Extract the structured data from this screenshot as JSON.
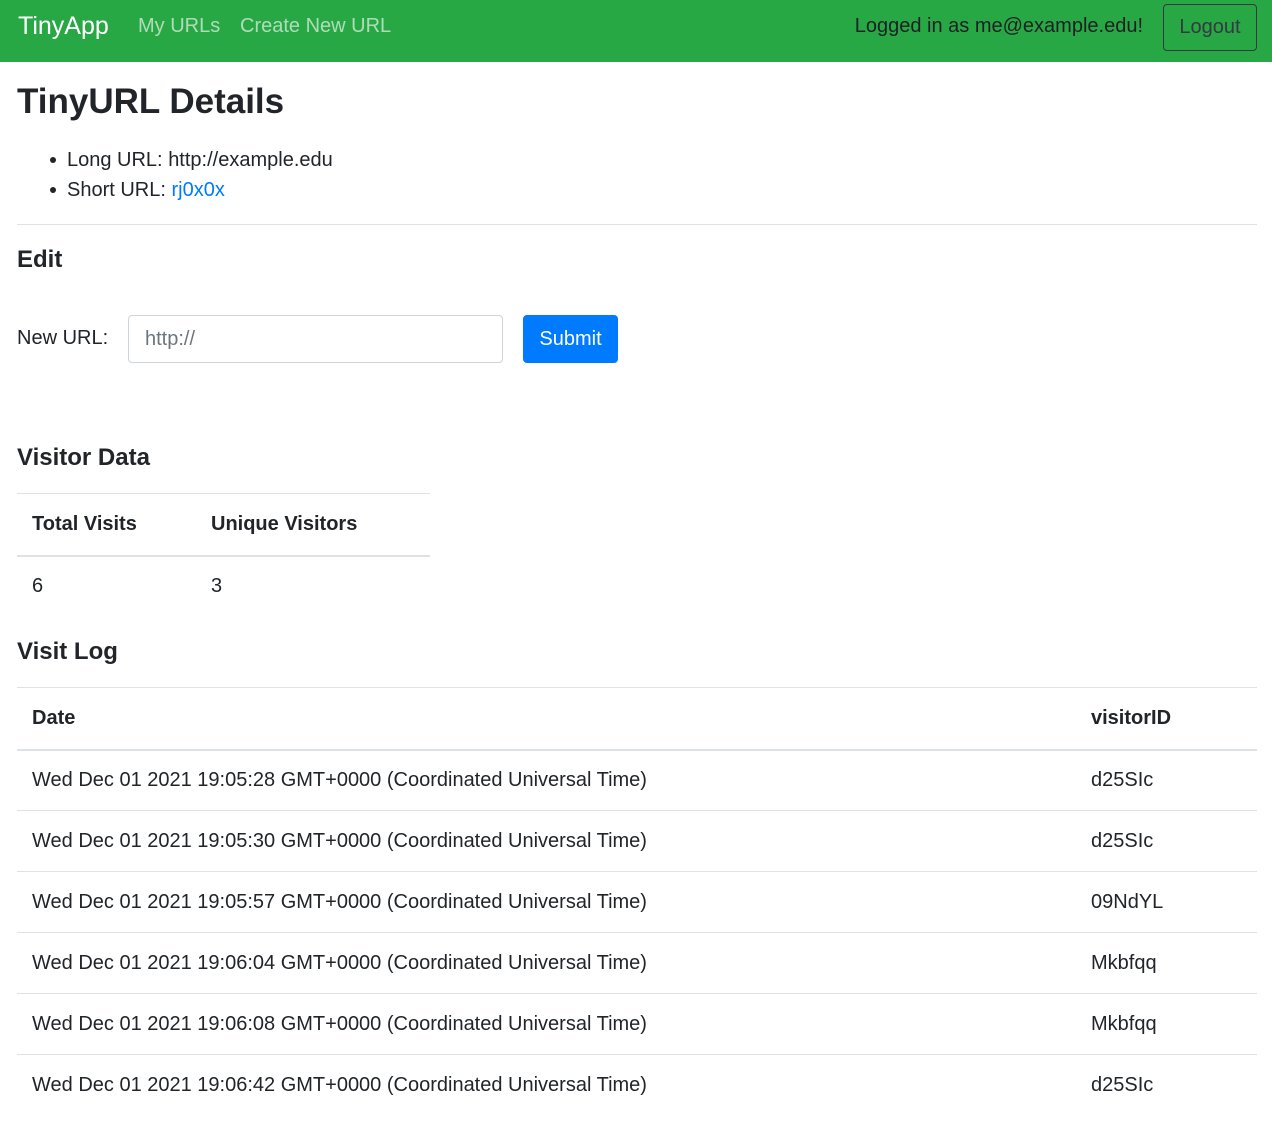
{
  "navbar": {
    "brand": "TinyApp",
    "links": [
      "My URLs",
      "Create New URL"
    ],
    "logged_in_text": "Logged in as me@example.edu!",
    "logout_label": "Logout",
    "bg_color": "#28a745"
  },
  "details": {
    "title": "TinyURL Details",
    "long_url_label": "Long URL:",
    "long_url_value": "http://example.edu",
    "short_url_label": "Short URL:",
    "short_url_value": "rj0x0x"
  },
  "edit": {
    "title": "Edit",
    "label": "New URL:",
    "placeholder": "http://",
    "value": "",
    "submit_label": "Submit",
    "submit_color": "#007bff"
  },
  "visitor_data": {
    "title": "Visitor Data",
    "headers": [
      "Total Visits",
      "Unique Visitors"
    ],
    "row": [
      "6",
      "3"
    ]
  },
  "visit_log": {
    "title": "Visit Log",
    "headers": [
      "Date",
      "visitorID"
    ],
    "rows": [
      [
        "Wed Dec 01 2021 19:05:28 GMT+0000 (Coordinated Universal Time)",
        "d25SIc"
      ],
      [
        "Wed Dec 01 2021 19:05:30 GMT+0000 (Coordinated Universal Time)",
        "d25SIc"
      ],
      [
        "Wed Dec 01 2021 19:05:57 GMT+0000 (Coordinated Universal Time)",
        "09NdYL"
      ],
      [
        "Wed Dec 01 2021 19:06:04 GMT+0000 (Coordinated Universal Time)",
        "Mkbfqq"
      ],
      [
        "Wed Dec 01 2021 19:06:08 GMT+0000 (Coordinated Universal Time)",
        "Mkbfqq"
      ],
      [
        "Wed Dec 01 2021 19:06:42 GMT+0000 (Coordinated Universal Time)",
        "d25SIc"
      ]
    ]
  }
}
